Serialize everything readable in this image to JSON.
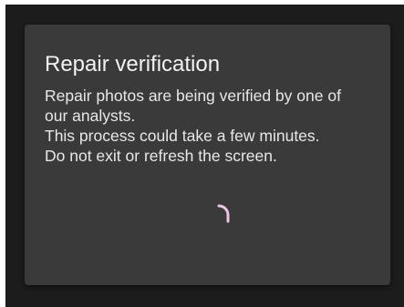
{
  "dialog": {
    "title": "Repair verification",
    "message_lines": [
      "Repair photos are being verified by one of",
      "our analysts.",
      "This process could take a few minutes.",
      "Do not exit or refresh the screen."
    ]
  },
  "spinner": {
    "icon": "loading-spinner-icon",
    "color": "#e9c6e2"
  },
  "colors": {
    "backdrop": "#1c1c1c",
    "dialog_background": "#3a3a3a",
    "title_text": "#f2f2f2",
    "body_text": "#e8e8e8"
  }
}
